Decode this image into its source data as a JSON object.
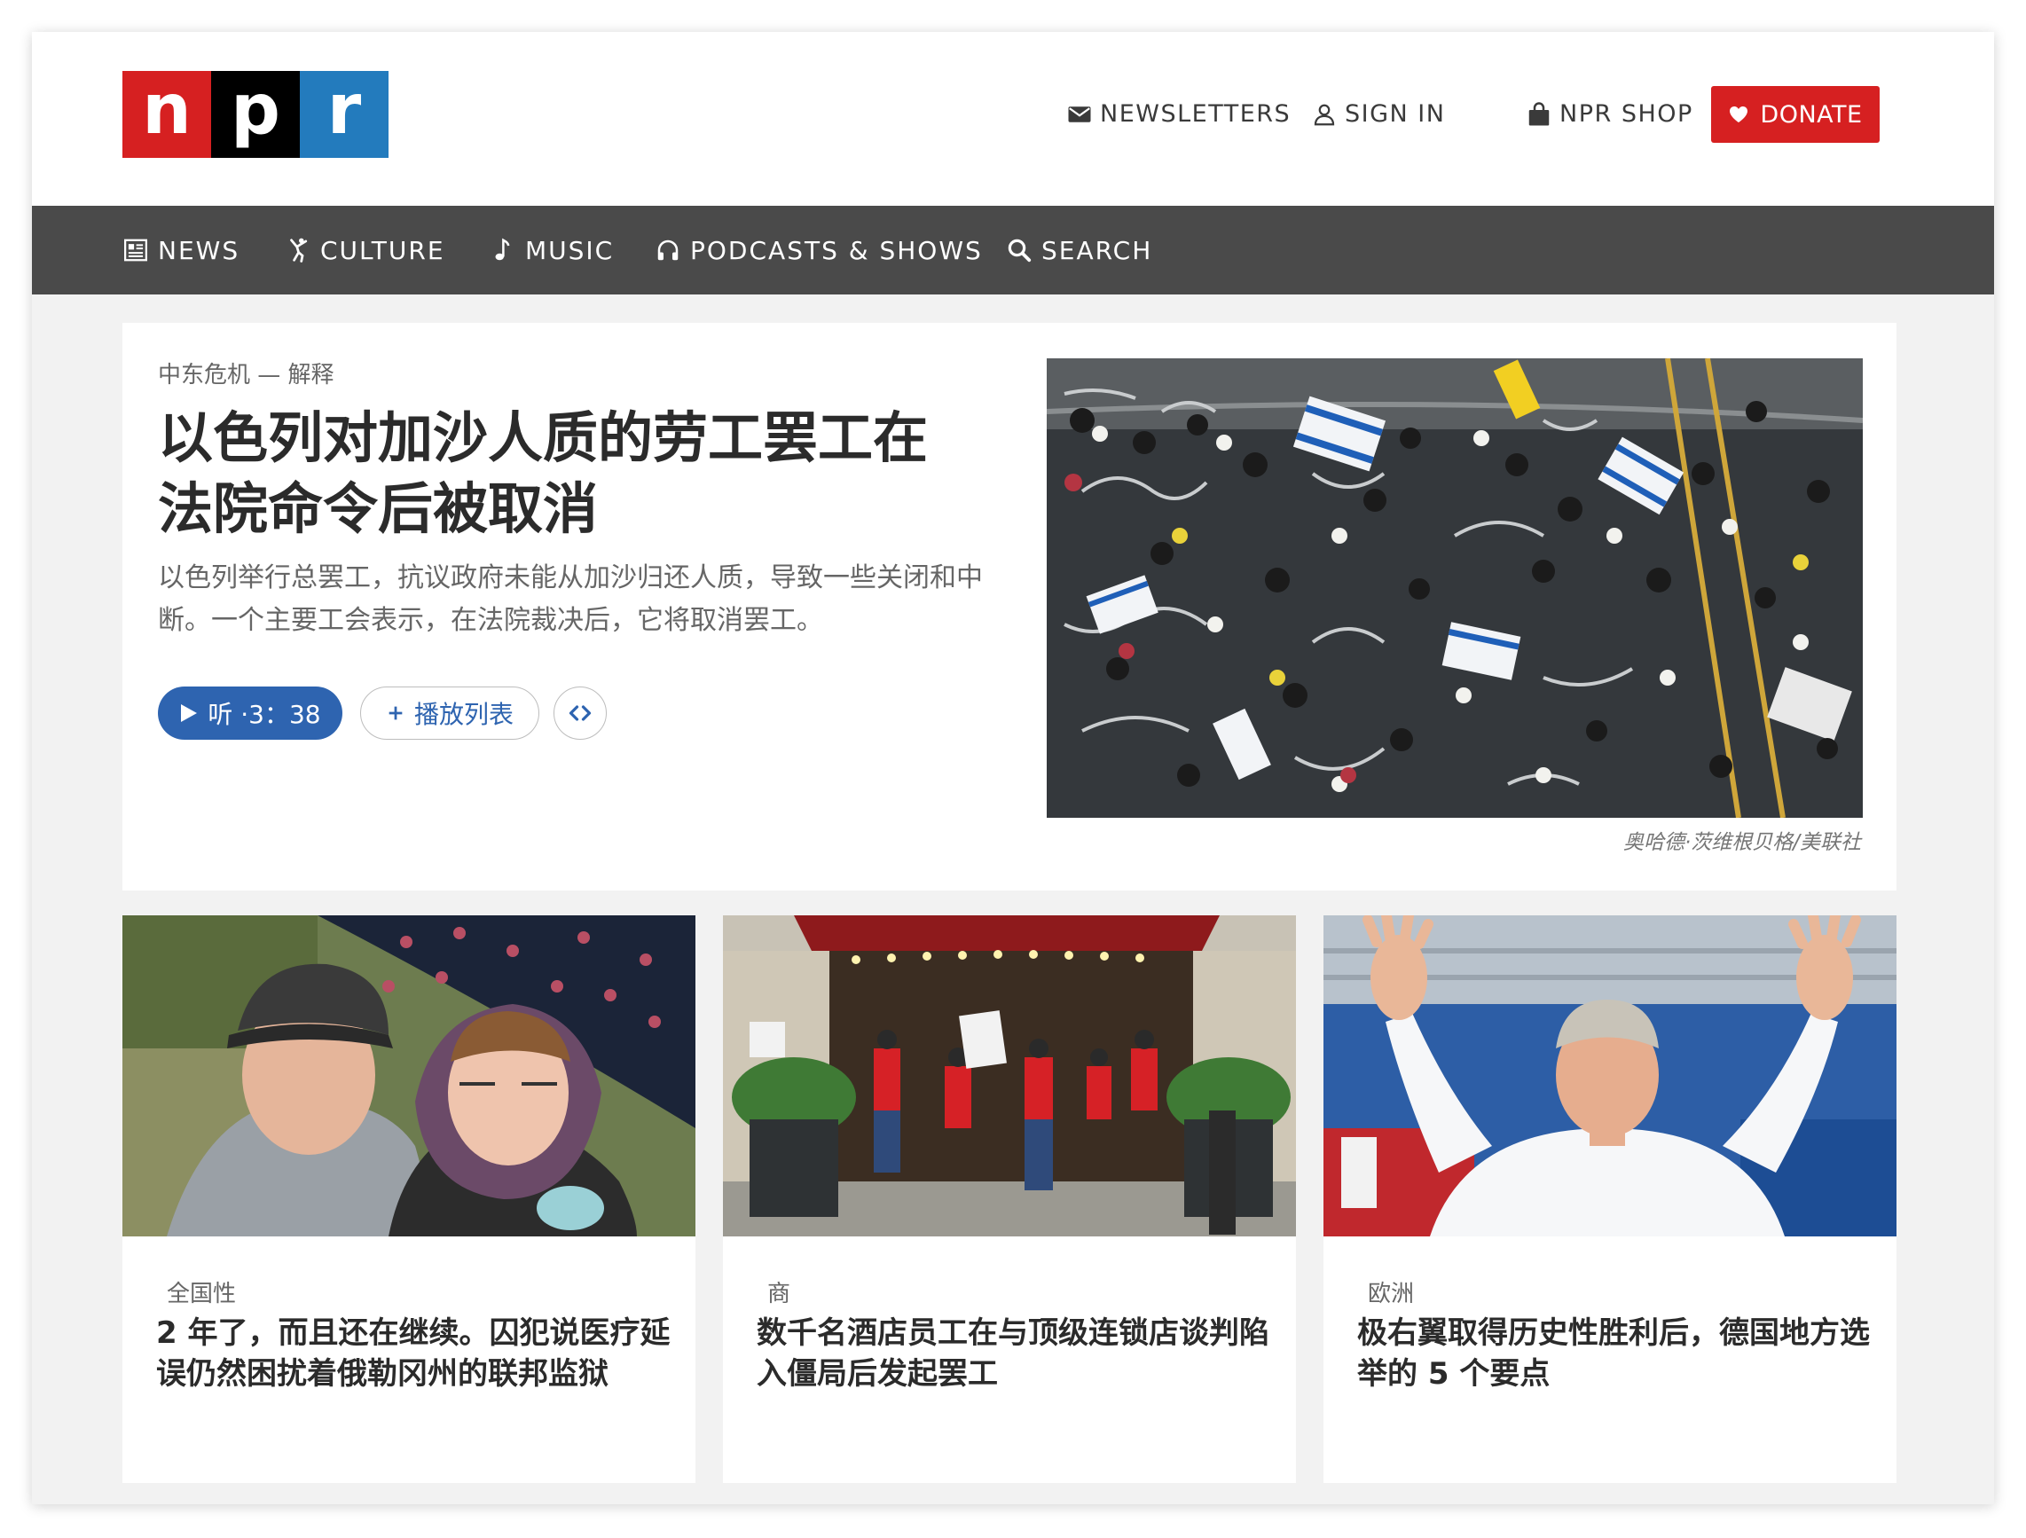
{
  "brand": {
    "logo_letters": [
      "n",
      "p",
      "r"
    ],
    "colors": {
      "red": "#d62021",
      "black": "#000000",
      "blue": "#237bbd",
      "nav_bg": "#4a4a4a",
      "link_blue": "#2e64b0"
    }
  },
  "utility_nav": {
    "newsletters": {
      "label": "NEWSLETTERS",
      "icon": "envelope-icon"
    },
    "sign_in": {
      "label": "SIGN IN",
      "icon": "user-icon"
    },
    "shop": {
      "label": "NPR SHOP",
      "icon": "shopping-bag-icon"
    },
    "donate": {
      "label": "DONATE",
      "icon": "heart-icon"
    }
  },
  "main_nav": {
    "items": [
      {
        "label": "NEWS",
        "icon": "newspaper-icon"
      },
      {
        "label": "CULTURE",
        "icon": "dancer-icon"
      },
      {
        "label": "MUSIC",
        "icon": "music-note-icon"
      },
      {
        "label": "PODCASTS & SHOWS",
        "icon": "headphones-icon"
      },
      {
        "label": "SEARCH",
        "icon": "search-icon"
      }
    ]
  },
  "featured": {
    "kicker": "中东危机 — 解释",
    "headline": "以色列对加沙人质的劳工罢工在法院命令后被取消",
    "teaser": "以色列举行总罢工，抗议政府未能从加沙归还人质，导致一些关闭和中断。一个主要工会表示，在法院裁决后，它将取消罢工。",
    "listen_label": "听 ·3：38",
    "playlist_label": "播放列表",
    "photo_credit": "奥哈德·茨维根贝格/美联社"
  },
  "stories": [
    {
      "kicker": "全国性",
      "title": "2 年了，而且还在继续。囚犯说医疗延误仍然困扰着俄勒冈州的联邦监狱"
    },
    {
      "kicker": "商",
      "title": "数千名酒店员工在与顶级连锁店谈判陷入僵局后发起罢工"
    },
    {
      "kicker": "欧洲",
      "title": "极右翼取得历史性胜利后，德国地方选举的 5 个要点"
    }
  ]
}
